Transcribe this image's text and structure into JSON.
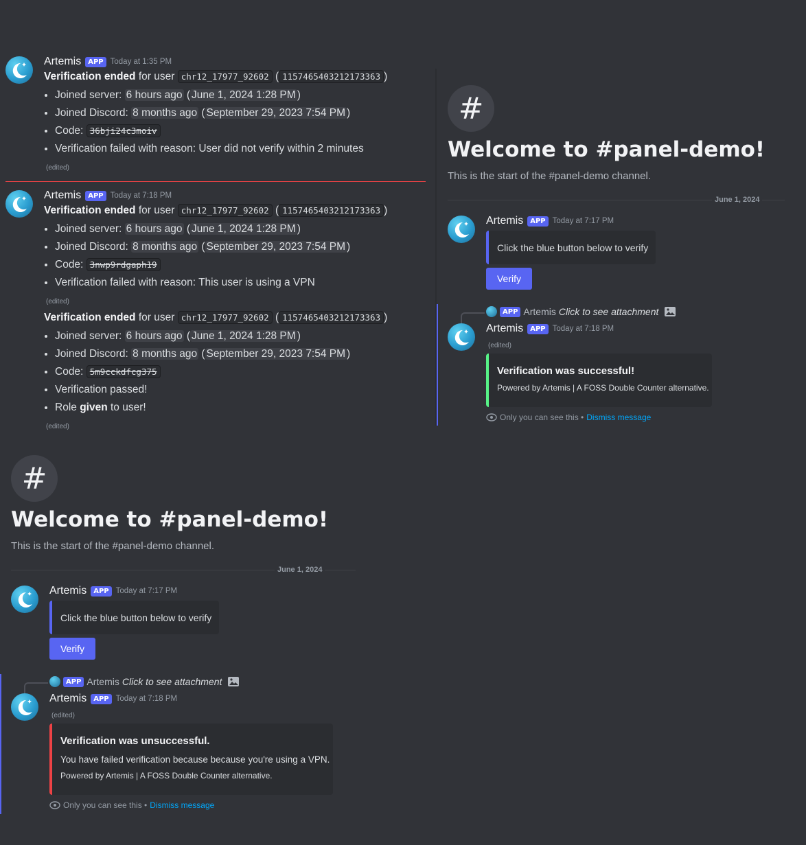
{
  "bot": {
    "name": "Artemis",
    "tag": "APP"
  },
  "colors": {
    "background": "#313338",
    "blurple": "#5865f2",
    "success": "#57f287",
    "danger": "#ed4245",
    "link": "#00a8fc"
  },
  "log1": {
    "timestamp": "Today at 1:35 PM",
    "title_bold": "Verification ended",
    "for_user": "for user",
    "username": "chr12_17977_92602",
    "user_id": "1157465403212173363",
    "joined_server_label": "Joined server:",
    "joined_server_rel": "6 hours ago",
    "joined_server_abs": "June 1, 2024 1:28 PM",
    "joined_discord_label": "Joined Discord:",
    "joined_discord_rel": "8 months ago",
    "joined_discord_abs": "September 29, 2023 7:54 PM",
    "code_label": "Code:",
    "code": "36bji24c3moiv",
    "reason": "Verification failed with reason: User did not verify within 2 minutes",
    "edited": "(edited)"
  },
  "log2": {
    "timestamp": "Today at 7:18 PM",
    "title_bold": "Verification ended",
    "for_user": "for user",
    "username": "chr12_17977_92602",
    "user_id": "1157465403212173363",
    "joined_server_label": "Joined server:",
    "joined_server_rel": "6 hours ago",
    "joined_server_abs": "June 1, 2024 1:28 PM",
    "joined_discord_label": "Joined Discord:",
    "joined_discord_rel": "8 months ago",
    "joined_discord_abs": "September 29, 2023 7:54 PM",
    "code_label": "Code:",
    "code": "3nwp9rdgaph19",
    "reason": "Verification failed with reason:  This user is using a VPN",
    "edited": "(edited)"
  },
  "log3": {
    "title_bold": "Verification ended",
    "for_user": "for user",
    "username": "chr12_17977_92602",
    "user_id": "1157465403212173363",
    "joined_server_label": "Joined server:",
    "joined_server_rel": "6 hours ago",
    "joined_server_abs": "June 1, 2024 1:28 PM",
    "joined_discord_label": "Joined Discord:",
    "joined_discord_rel": "8 months ago",
    "joined_discord_abs": "September 29, 2023 7:54 PM",
    "code_label": "Code:",
    "code": "5m9cckdfcg375",
    "passed": "Verification passed!",
    "role_pre": "Role",
    "role_bold": "given",
    "role_post": "to user!",
    "edited": "(edited)"
  },
  "panel_success": {
    "hash": "#",
    "welcome": "Welcome to #panel-demo!",
    "start": "This is the start of the #panel-demo channel.",
    "date": "June 1, 2024",
    "msg1_time": "Today at 7:17 PM",
    "prompt": "Click the blue button below to verify",
    "verify_button": "Verify",
    "reply_text": "Artemis",
    "reply_attach": "Click to see attachment",
    "msg2_time": "Today at 7:18 PM",
    "edited": "(edited)",
    "embed_title": "Verification was successful!",
    "embed_footer": "Powered by Artemis | A FOSS Double Counter alternative.",
    "only_you": "Only you can see this •",
    "dismiss": "Dismiss message"
  },
  "panel_fail": {
    "hash": "#",
    "welcome": "Welcome to #panel-demo!",
    "start": "This is the start of the #panel-demo channel.",
    "date": "June 1, 2024",
    "msg1_time": "Today at 7:17 PM",
    "prompt": "Click the blue button below to verify",
    "verify_button": "Verify",
    "reply_text": "Artemis",
    "reply_attach": "Click to see attachment",
    "msg2_time": "Today at 7:18 PM",
    "edited": "(edited)",
    "embed_title": "Verification was unsuccessful.",
    "embed_desc": "You have failed verification because because you're using a VPN.",
    "embed_footer": "Powered by Artemis | A FOSS Double Counter alternative.",
    "only_you": "Only you can see this •",
    "dismiss": "Dismiss message"
  }
}
